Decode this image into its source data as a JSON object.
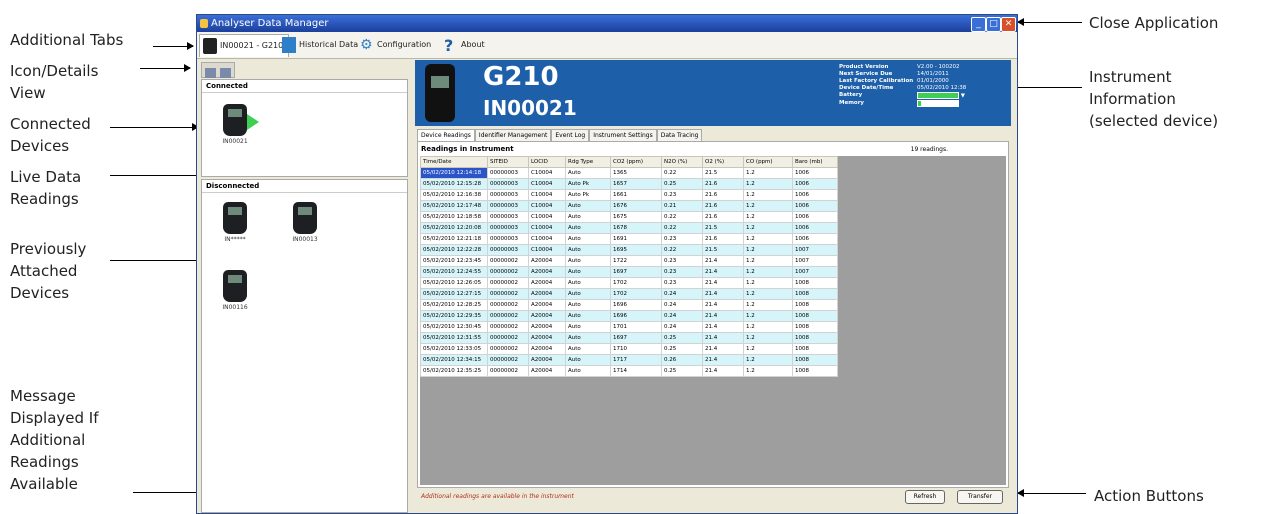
{
  "callouts": {
    "additional_tabs": "Additional Tabs",
    "icon_details_view": "Icon/Details\nView",
    "connected_devices": "Connected\nDevices",
    "live_data_readings": "Live Data\nReadings",
    "previously_attached": "Previously\nAttached\nDevices",
    "message_displayed": "Message\nDisplayed If\nAdditional\nReadings\nAvailable",
    "close_application": "Close Application",
    "instrument_information": "Instrument\nInformation\n(selected device)",
    "action_buttons": "Action Buttons"
  },
  "window": {
    "title": "Analyser Data Manager",
    "tabs": [
      "IN00021 - G210",
      "Historical Data",
      "Configuration",
      "About"
    ]
  },
  "left": {
    "connected_header": "Connected",
    "disconnected_header": "Disconnected",
    "connected_devices": [
      "IN00021"
    ],
    "disconnected_devices": [
      "IN*****",
      "IN00013",
      "IN00116"
    ]
  },
  "instrument": {
    "model": "G210",
    "serial": "IN00021",
    "info": [
      {
        "k": "Product Version",
        "v": "V2.00 - 100202"
      },
      {
        "k": "Next Service Due",
        "v": "14/01/2011"
      },
      {
        "k": "Last Factory Calibration",
        "v": "01/01/2000"
      },
      {
        "k": "Device Date/Time",
        "v": "05/02/2010 12:38"
      },
      {
        "k": "Battery",
        "v": ""
      },
      {
        "k": "Memory",
        "v": ""
      }
    ]
  },
  "subtabs": [
    "Device Readings",
    "Identifier Management",
    "Event Log",
    "Instrument Settings",
    "Data Tracing"
  ],
  "readings": {
    "title": "Readings in Instrument",
    "count": "19 readings.",
    "columns": [
      "Time/Date",
      "SITEID",
      "LOCID",
      "Rdg Type",
      "CO2 (ppm)",
      "N2O (%)",
      "O2 (%)",
      "CO (ppm)",
      "Baro (mb)"
    ],
    "rows": [
      [
        "05/02/2010 12:14:18",
        "00000003",
        "C10004",
        "Auto",
        "1365",
        "0.22",
        "21.5",
        "1.2",
        "1006"
      ],
      [
        "05/02/2010 12:15:28",
        "00000003",
        "C10004",
        "Auto Pk",
        "1657",
        "0.25",
        "21.6",
        "1.2",
        "1006"
      ],
      [
        "05/02/2010 12:16:38",
        "00000003",
        "C10004",
        "Auto Pk",
        "1661",
        "0.23",
        "21.6",
        "1.2",
        "1006"
      ],
      [
        "05/02/2010 12:17:48",
        "00000003",
        "C10004",
        "Auto",
        "1676",
        "0.21",
        "21.6",
        "1.2",
        "1006"
      ],
      [
        "05/02/2010 12:18:58",
        "00000003",
        "C10004",
        "Auto",
        "1675",
        "0.22",
        "21.6",
        "1.2",
        "1006"
      ],
      [
        "05/02/2010 12:20:08",
        "00000003",
        "C10004",
        "Auto",
        "1678",
        "0.22",
        "21.5",
        "1.2",
        "1006"
      ],
      [
        "05/02/2010 12:21:18",
        "00000003",
        "C10004",
        "Auto",
        "1691",
        "0.23",
        "21.6",
        "1.2",
        "1006"
      ],
      [
        "05/02/2010 12:22:28",
        "00000003",
        "C10004",
        "Auto",
        "1695",
        "0.22",
        "21.5",
        "1.2",
        "1007"
      ],
      [
        "05/02/2010 12:23:45",
        "00000002",
        "A20004",
        "Auto",
        "1722",
        "0.23",
        "21.4",
        "1.2",
        "1007"
      ],
      [
        "05/02/2010 12:24:55",
        "00000002",
        "A20004",
        "Auto",
        "1697",
        "0.23",
        "21.4",
        "1.2",
        "1007"
      ],
      [
        "05/02/2010 12:26:05",
        "00000002",
        "A20004",
        "Auto",
        "1702",
        "0.23",
        "21.4",
        "1.2",
        "1008"
      ],
      [
        "05/02/2010 12:27:15",
        "00000002",
        "A20004",
        "Auto",
        "1702",
        "0.24",
        "21.4",
        "1.2",
        "1008"
      ],
      [
        "05/02/2010 12:28:25",
        "00000002",
        "A20004",
        "Auto",
        "1696",
        "0.24",
        "21.4",
        "1.2",
        "1008"
      ],
      [
        "05/02/2010 12:29:35",
        "00000002",
        "A20004",
        "Auto",
        "1696",
        "0.24",
        "21.4",
        "1.2",
        "1008"
      ],
      [
        "05/02/2010 12:30:45",
        "00000002",
        "A20004",
        "Auto",
        "1701",
        "0.24",
        "21.4",
        "1.2",
        "1008"
      ],
      [
        "05/02/2010 12:31:55",
        "00000002",
        "A20004",
        "Auto",
        "1697",
        "0.25",
        "21.4",
        "1.2",
        "1008"
      ],
      [
        "05/02/2010 12:33:05",
        "00000002",
        "A20004",
        "Auto",
        "1710",
        "0.25",
        "21.4",
        "1.2",
        "1008"
      ],
      [
        "05/02/2010 12:34:15",
        "00000002",
        "A20004",
        "Auto",
        "1717",
        "0.26",
        "21.4",
        "1.2",
        "1008"
      ],
      [
        "05/02/2010 12:35:25",
        "00000002",
        "A20004",
        "Auto",
        "1714",
        "0.25",
        "21.4",
        "1.2",
        "1008"
      ]
    ]
  },
  "status": {
    "message": "Additional readings are available in the instrument",
    "refresh": "Refresh",
    "transfer": "Transfer"
  },
  "colors": {
    "title_bar": "#1b3f9c",
    "info_bar": "#1d5fa8",
    "selected_cell": "#2a54c8",
    "alt_row": "#d6f5fa",
    "message": "#b03020"
  }
}
